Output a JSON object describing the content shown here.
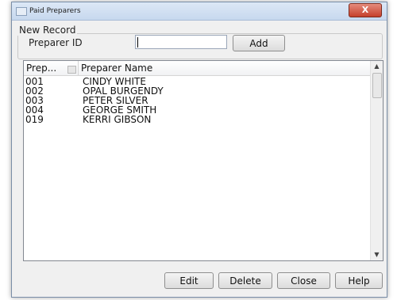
{
  "window": {
    "title": "Paid Preparers",
    "close_label": "X"
  },
  "new_record": {
    "legend": "New Record",
    "field_label": "Preparer ID",
    "input_value": "",
    "add_label": "Add"
  },
  "list": {
    "columns": [
      "Prep...",
      "Preparer Name"
    ],
    "rows": [
      {
        "id": "001",
        "name": "CINDY WHITE"
      },
      {
        "id": "002",
        "name": "OPAL BURGENDY"
      },
      {
        "id": "003",
        "name": "PETER SILVER"
      },
      {
        "id": "004",
        "name": "GEORGE SMITH"
      },
      {
        "id": "019",
        "name": "KERRI GIBSON"
      }
    ]
  },
  "buttons": {
    "edit": "Edit",
    "delete": "Delete",
    "close": "Close",
    "help": "Help"
  },
  "icons": {
    "window": "app-icon",
    "sort": "sort-icon",
    "scroll_up": "scroll-up-arrow-icon",
    "scroll_down": "scroll-down-arrow-icon"
  }
}
